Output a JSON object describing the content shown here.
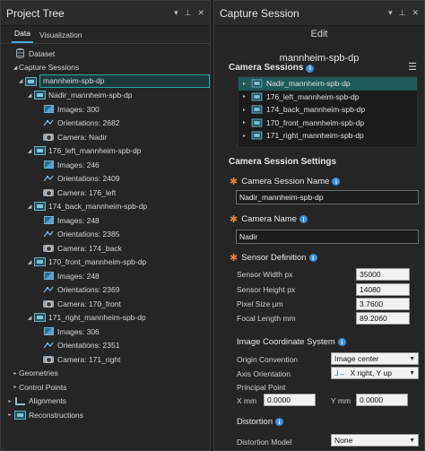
{
  "left_panel": {
    "title": "Project Tree",
    "tabs": [
      "Data",
      "Visualization"
    ],
    "tree": {
      "dataset": "Dataset",
      "capture_sessions": "Capture Sessions",
      "selected_session": "mannheim-spb-dp",
      "sessions": [
        {
          "name": "Nadir_mannheim-spb-dp",
          "images": "Images: 300",
          "orientations": "Orientations: 2682",
          "camera": "Camera: Nadir"
        },
        {
          "name": "176_left_mannheim-spb-dp",
          "images": "Images: 246",
          "orientations": "Orientations: 2409",
          "camera": "Camera: 176_left"
        },
        {
          "name": "174_back_mannheim-spb-dp",
          "images": "Images: 248",
          "orientations": "Orientations: 2385",
          "camera": "Camera: 174_back"
        },
        {
          "name": "170_front_mannheim-spb-dp",
          "images": "Images: 248",
          "orientations": "Orientations: 2369",
          "camera": "Camera: 170_front"
        },
        {
          "name": "171_right_mannheim-spb-dp",
          "images": "Images: 306",
          "orientations": "Orientations: 2351",
          "camera": "Camera: 171_right"
        }
      ],
      "geometries": "Geometries",
      "control_points": "Control Points",
      "alignments": "Alignments",
      "reconstructions": "Reconstructions"
    }
  },
  "right_panel": {
    "title": "Capture Session",
    "subtitle": "Edit",
    "session_name": "mannheim-spb-dp",
    "camera_sessions_header": "Camera Sessions",
    "camera_sessions": [
      "Nadir_mannheim-spb-dp",
      "176_left_mannheim-spb-dp",
      "174_back_mannheim-spb-dp",
      "170_front_mannheim-spb-dp",
      "171_right_mannheim-spb-dp"
    ],
    "settings_header": "Camera Session Settings",
    "camera_session_name_label": "Camera Session Name",
    "camera_session_name_value": "Nadir_mannheim-spb-dp",
    "camera_name_label": "Camera Name",
    "camera_name_value": "Nadir",
    "sensor_definition_label": "Sensor Definition",
    "sensor_width_label": "Sensor Width px",
    "sensor_width_value": "35000",
    "sensor_height_label": "Sensor Height px",
    "sensor_height_value": "14080",
    "pixel_size_label": "Pixel Size µm",
    "pixel_size_value": "3.7600",
    "focal_length_label": "Focal Length mm",
    "focal_length_value": "89.2060",
    "image_coord_label": "Image Coordinate System",
    "origin_label": "Origin Convention",
    "origin_value": "Image center",
    "axis_label": "Axis Orientation",
    "axis_value": "X right, Y up",
    "principal_point_label": "Principal Point",
    "x_mm_label": "X mm",
    "x_mm_value": "0.0000",
    "y_mm_label": "Y mm",
    "y_mm_value": "0.0000",
    "distortion_label": "Distortion",
    "distortion_model_label": "Distortion Model",
    "distortion_model_value": "None"
  },
  "colors": {
    "accent": "#4ea5d9",
    "selection": "#1e5a58",
    "required": "#e0823d",
    "info": "#3f8fd8"
  }
}
